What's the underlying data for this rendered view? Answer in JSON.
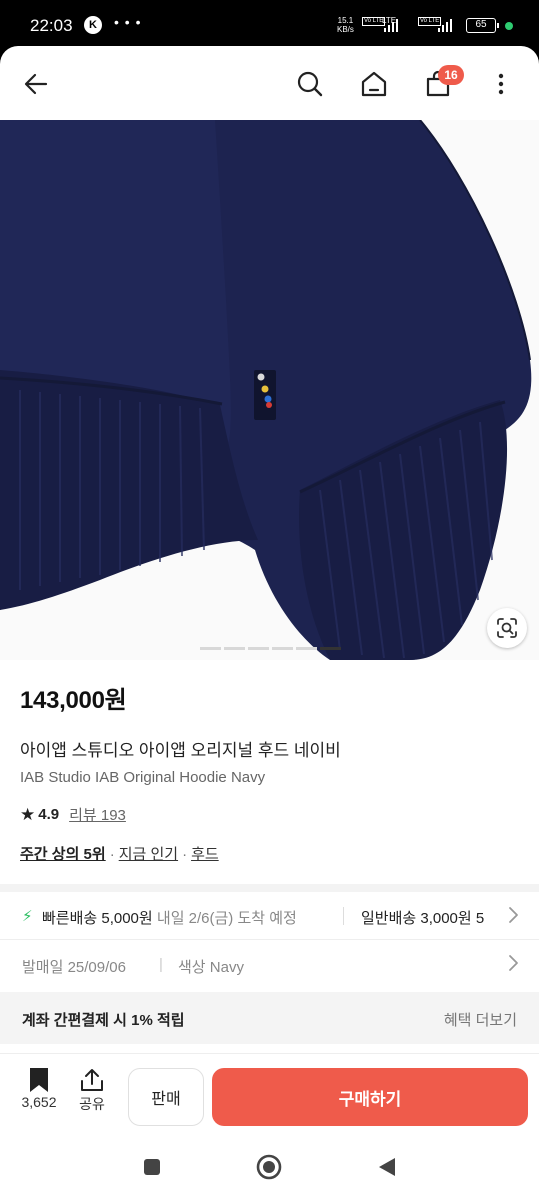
{
  "status_bar": {
    "time": "22:03",
    "notification_icon": "K",
    "more_notifications": "• • •",
    "net_speed_value": "15.1",
    "net_speed_unit": "KB/s",
    "volte1": "Vo LTE",
    "lte": "LTE",
    "volte2": "Vo LTE",
    "battery": "65"
  },
  "header": {
    "back_icon": "arrow-left-icon",
    "search_icon": "search-icon",
    "home_icon": "home-icon",
    "cart_icon": "shopping-bag-icon",
    "cart_count": "16",
    "more_icon": "more-vertical-icon"
  },
  "gallery": {
    "image_count": 6,
    "active_index": 5,
    "lens_icon": "lens-scan-icon"
  },
  "product": {
    "price": "143,000원",
    "title_ko": "아이앱 스튜디오 아이앱 오리지널 후드 네이비",
    "title_en": "IAB Studio IAB Original Hoodie Navy",
    "rating": "4.9",
    "reviews": "리뷰 193",
    "rank_main": "주간 상의 5위",
    "rank_popular": "지금 인기",
    "rank_category": "후드"
  },
  "shipping": {
    "fast_label": "빠른배송 5,000원",
    "fast_eta": "내일 2/6(금) 도착 예정",
    "normal_label": "일반배송 3,000원 5",
    "chevron_icon": "chevron-right-icon"
  },
  "meta": {
    "release": "발매일 25/09/06",
    "color": "색상 Navy"
  },
  "benefit": {
    "label": "계좌 간편결제 시 1% 적립",
    "more": "혜택 더보기"
  },
  "bottom_bar": {
    "bookmark_count": "3,652",
    "share_label": "공유",
    "sell_label": "판매",
    "buy_label": "구매하기"
  },
  "colors": {
    "accent": "#ef5b4b",
    "fast_ship": "#2dbf63",
    "hoodie_navy": "#1b2148"
  }
}
